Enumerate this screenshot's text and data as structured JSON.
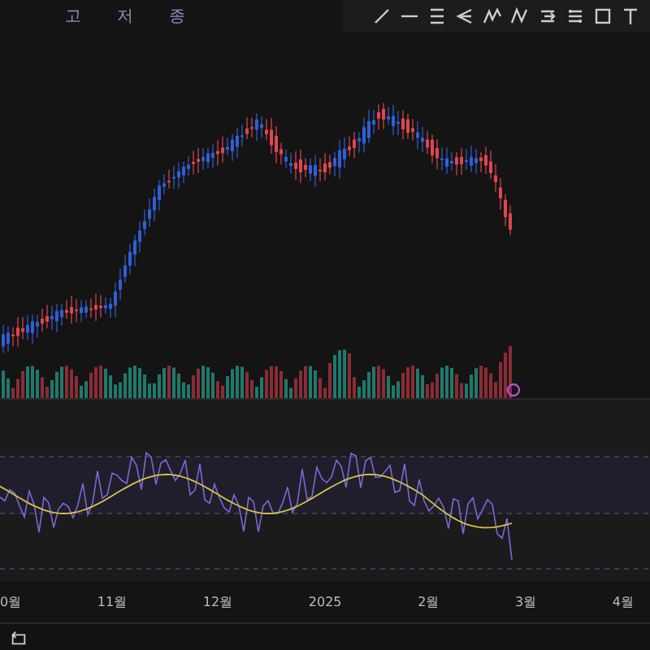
{
  "legend": [
    {
      "label": "고"
    },
    {
      "label": "저"
    },
    {
      "label": "종"
    }
  ],
  "time_axis": [
    "0월",
    "11월",
    "12월",
    "2025",
    "2월",
    "3월",
    "4월"
  ]
}
